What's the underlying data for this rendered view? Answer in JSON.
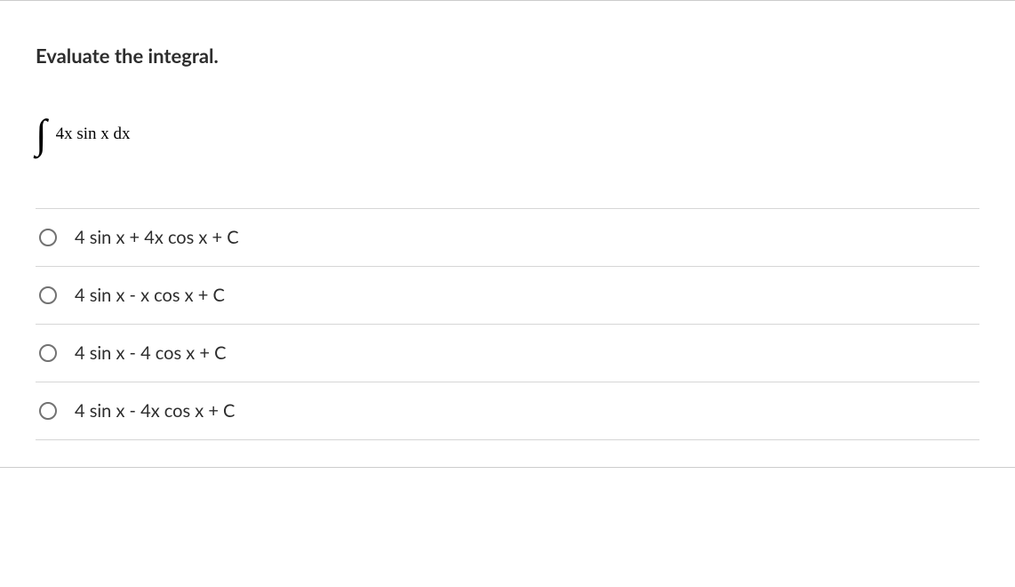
{
  "question": {
    "prompt": "Evaluate the integral.",
    "integral_expr": "4x sin x dx"
  },
  "options": [
    {
      "label": "4 sin x + 4x cos x + C"
    },
    {
      "label": "4 sin x - x cos x + C"
    },
    {
      "label": "4 sin x - 4 cos x + C"
    },
    {
      "label": "4 sin x - 4x cos x + C"
    }
  ]
}
